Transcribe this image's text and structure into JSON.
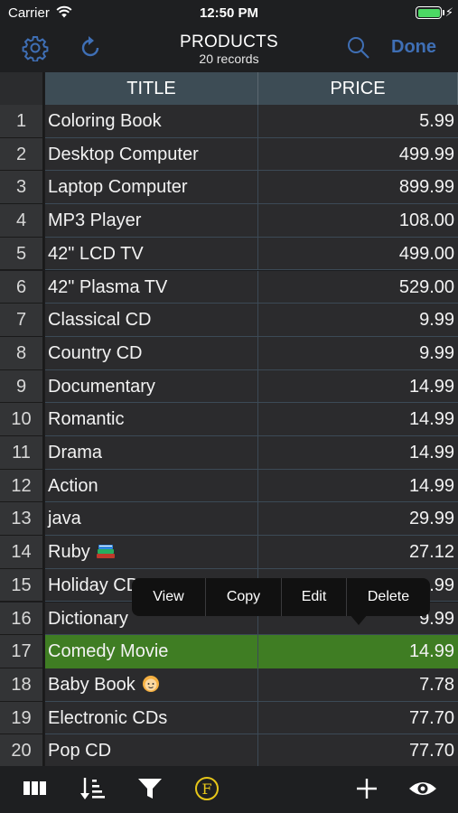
{
  "status_bar": {
    "carrier": "Carrier",
    "time": "12:50 PM",
    "battery_level": 1.0,
    "battery_color": "#4cd964"
  },
  "navbar": {
    "title": "PRODUCTS",
    "subtitle": "20 records",
    "done_label": "Done",
    "left_icons": [
      "gear-icon",
      "refresh-icon"
    ],
    "right_icons": [
      "search-icon"
    ],
    "accent_color": "#3f6fb5"
  },
  "table": {
    "columns": [
      "TITLE",
      "PRICE"
    ],
    "selected_row": 17,
    "selected_color": "#3f7d23",
    "rows": [
      {
        "num": "1",
        "title": "Coloring Book",
        "price": "5.99"
      },
      {
        "num": "2",
        "title": "Desktop Computer",
        "price": "499.99"
      },
      {
        "num": "3",
        "title": "Laptop Computer",
        "price": "899.99"
      },
      {
        "num": "4",
        "title": "MP3 Player",
        "price": "108.00"
      },
      {
        "num": "5",
        "title": "42\" LCD TV",
        "price": "499.00"
      },
      {
        "num": "6",
        "title": "42\" Plasma TV",
        "price": "529.00"
      },
      {
        "num": "7",
        "title": "Classical CD",
        "price": "9.99"
      },
      {
        "num": "8",
        "title": "Country CD",
        "price": "9.99"
      },
      {
        "num": "9",
        "title": "Documentary",
        "price": "14.99"
      },
      {
        "num": "10",
        "title": "Romantic",
        "price": "14.99"
      },
      {
        "num": "11",
        "title": "Drama",
        "price": "14.99"
      },
      {
        "num": "12",
        "title": "Action",
        "price": "14.99"
      },
      {
        "num": "13",
        "title": "java",
        "price": "29.99"
      },
      {
        "num": "14",
        "title": "Ruby",
        "emoji": "books-emoji",
        "price": "27.12"
      },
      {
        "num": "15",
        "title": "Holiday CD",
        "price": ".99"
      },
      {
        "num": "16",
        "title": "Dictionary",
        "price": "9.99"
      },
      {
        "num": "17",
        "title": "Comedy Movie",
        "price": "14.99"
      },
      {
        "num": "18",
        "title": "Baby Book",
        "emoji": "baby-face-emoji",
        "price": "7.78"
      },
      {
        "num": "19",
        "title": "Electronic CDs",
        "price": "77.70"
      },
      {
        "num": "20",
        "title": "Pop CD",
        "price": "77.70"
      }
    ]
  },
  "context_menu": {
    "items": [
      "View",
      "Copy",
      "Edit",
      "Delete"
    ]
  },
  "toolbar": {
    "icons": [
      "columns-icon",
      "sort-icon",
      "filter-icon",
      "formula-icon",
      "add-icon",
      "eye-icon"
    ],
    "formula_color": "#e6c619"
  }
}
